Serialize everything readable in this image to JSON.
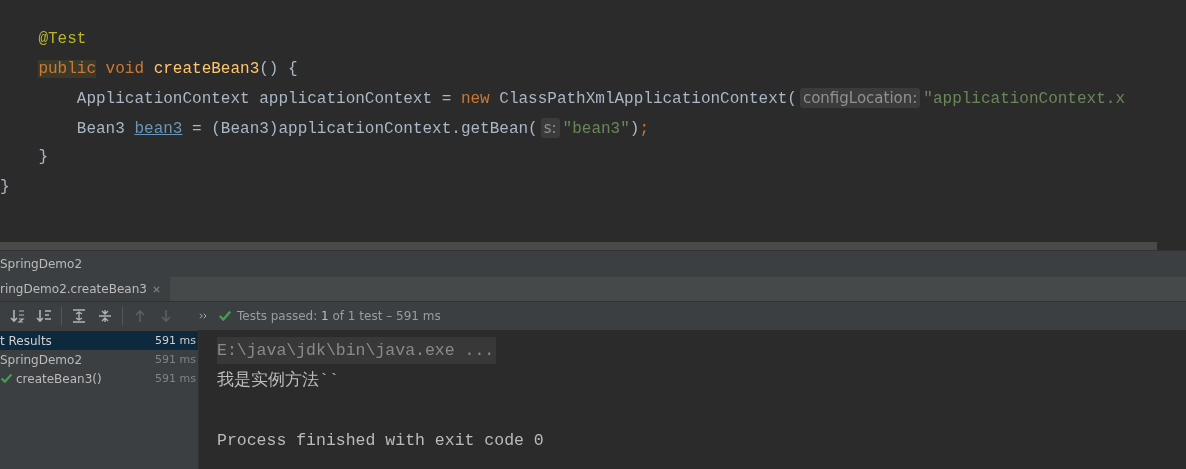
{
  "editor": {
    "lines": [
      {
        "children": [
          {
            "tokens": [
              {
                "kind": "annotation",
                "text": "@Test"
              }
            ]
          },
          {
            "tokens": [
              {
                "kind": "keyword",
                "text": "public",
                "highlighted": true
              },
              {
                "kind": "keyword",
                "text": " void "
              },
              {
                "kind": "method",
                "text": "createBean3"
              },
              {
                "kind": "plain",
                "text": "() {"
              }
            ],
            "children": [
              {
                "tokens": [
                  {
                    "kind": "plain",
                    "text": "ApplicationContext applicationContext = "
                  },
                  {
                    "kind": "keyword",
                    "text": "new "
                  },
                  {
                    "kind": "plain",
                    "text": "ClassPathXmlApplicationContext("
                  },
                  {
                    "kind": "hint",
                    "text": "configLocation:"
                  },
                  {
                    "kind": "string",
                    "text": "\"applicationContext.x"
                  }
                ]
              },
              {
                "tokens": [
                  {
                    "kind": "plain",
                    "text": "Bean3 "
                  },
                  {
                    "kind": "link",
                    "text": "bean3"
                  },
                  {
                    "kind": "plain",
                    "text": " = (Bean3)applicationContext.getBean("
                  },
                  {
                    "kind": "hint",
                    "text": "s:"
                  },
                  {
                    "kind": "string",
                    "text": "\"bean3\""
                  },
                  {
                    "kind": "plain",
                    "text": ")"
                  },
                  {
                    "kind": "keyword",
                    "text": ";"
                  }
                ]
              }
            ]
          },
          {
            "tokens": [
              {
                "kind": "plain",
                "text": "}"
              }
            ]
          }
        ]
      },
      {
        "tokens": [
          {
            "kind": "plain",
            "text": "}"
          }
        ]
      }
    ]
  },
  "run_panel": {
    "title": "SpringDemo2",
    "tabs": [
      {
        "label": "ringDemo2.createBean3",
        "selected": true
      }
    ],
    "status": "Tests passed: **1** of 1 test – 591 ms",
    "tree": [
      {
        "label": "t Results",
        "time": "591 ms",
        "selected": true,
        "children": [
          {
            "label": "SpringDemo2",
            "time": "591 ms",
            "selected": false,
            "children": [
              {
                "label": "createBean3()",
                "time": "591 ms",
                "selected": false,
                "passed": true
              }
            ]
          }
        ]
      }
    ],
    "console": [
      {
        "text": "E:\\java\\jdk\\bin\\java.exe ...",
        "kind": "command"
      },
      {
        "text": "我是实例方法``",
        "kind": "output"
      },
      {
        "kind": "blank"
      },
      {
        "text": "Process finished with exit code 0",
        "kind": "output"
      }
    ]
  }
}
